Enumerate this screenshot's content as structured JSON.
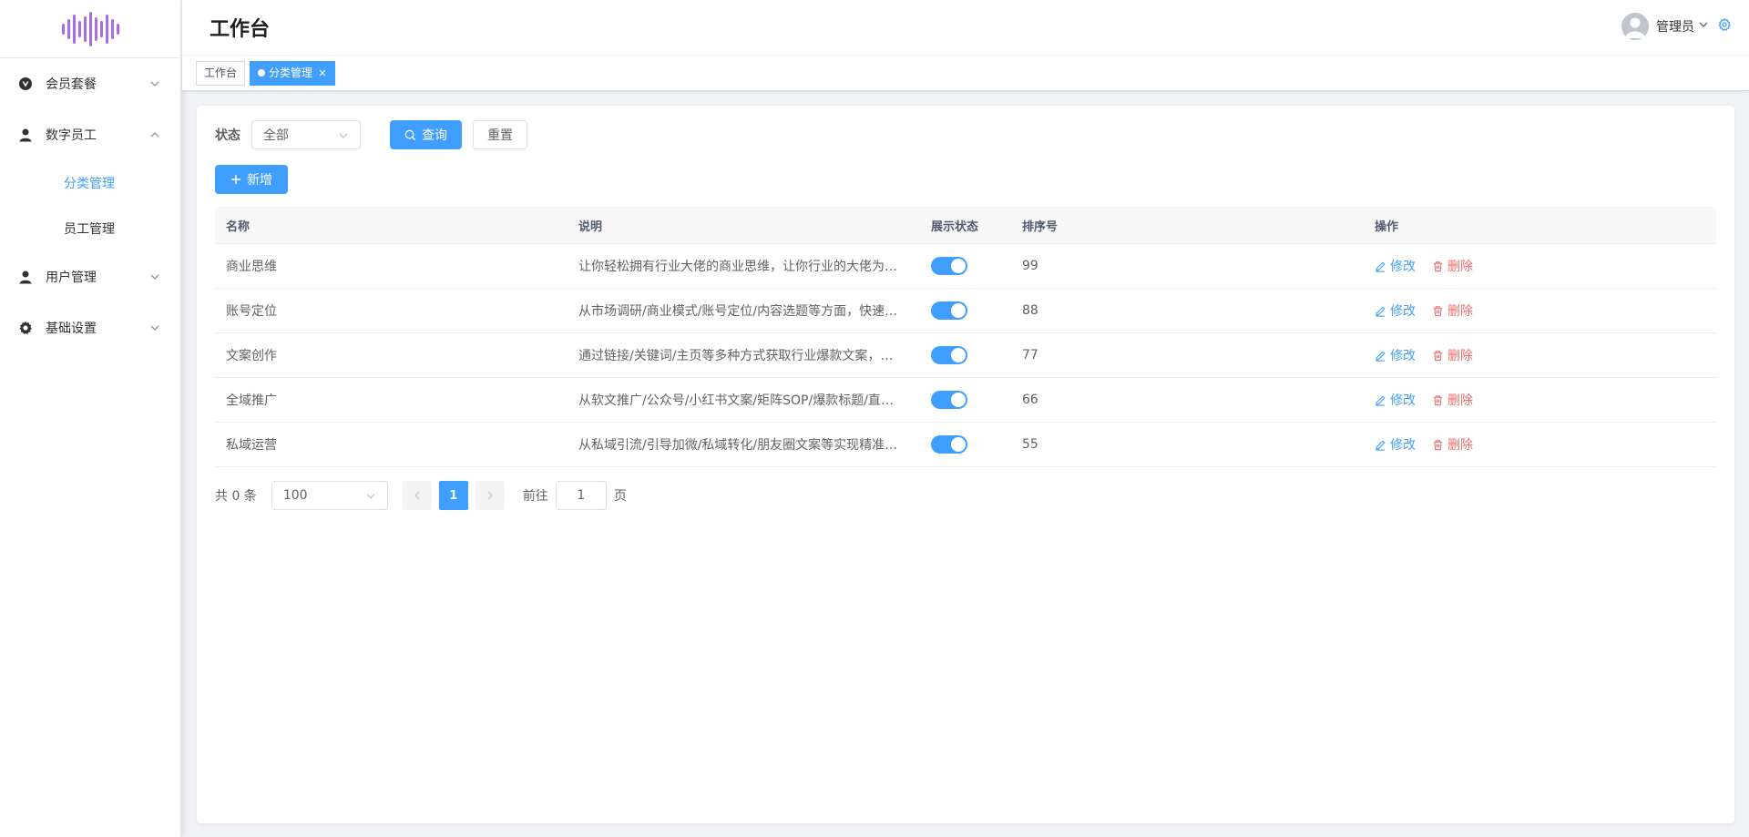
{
  "sidebar": {
    "items": [
      {
        "label": "会员套餐",
        "icon": "vuejs-icon",
        "expanded": false
      },
      {
        "label": "数字员工",
        "icon": "user-icon",
        "expanded": true,
        "children": [
          {
            "label": "分类管理",
            "active": true
          },
          {
            "label": "员工管理",
            "active": false
          }
        ]
      },
      {
        "label": "用户管理",
        "icon": "user-icon",
        "expanded": false
      },
      {
        "label": "基础设置",
        "icon": "gear-icon",
        "expanded": false
      }
    ]
  },
  "header": {
    "title": "工作台",
    "user_name": "管理员"
  },
  "tags": [
    {
      "label": "工作台",
      "active": false
    },
    {
      "label": "分类管理",
      "active": true,
      "close": "×"
    }
  ],
  "filter": {
    "status_label": "状态",
    "status_value": "全部",
    "search_label": "查询",
    "reset_label": "重置",
    "add_label": "新增"
  },
  "table": {
    "columns": [
      "名称",
      "说明",
      "展示状态",
      "排序号",
      "操作"
    ],
    "rows": [
      {
        "name": "商业思维",
        "desc": "让你轻松拥有行业大佬的商业思维，让你行业的大佬为…",
        "enabled": true,
        "sort": "99"
      },
      {
        "name": "账号定位",
        "desc": "从市场调研/商业模式/账号定位/内容选题等方面，快速…",
        "enabled": true,
        "sort": "88"
      },
      {
        "name": "文案创作",
        "desc": "通过链接/关键词/主页等多种方式获取行业爆款文案，并…",
        "enabled": true,
        "sort": "77"
      },
      {
        "name": "全域推广",
        "desc": "从软文推广/公众号/小红书文案/矩阵SOP/爆款标题/直播…",
        "enabled": true,
        "sort": "66"
      },
      {
        "name": "私域运营",
        "desc": "从私域引流/引导加微/私域转化/朋友圈文案等实现精准…",
        "enabled": true,
        "sort": "55"
      }
    ],
    "edit_label": "修改",
    "delete_label": "删除"
  },
  "pagination": {
    "total_text": "共 0 条",
    "page_size": "100",
    "current_page": "1",
    "jump_label": "前往",
    "jump_value": "1",
    "page_unit": "页"
  },
  "colors": {
    "accent": "#409eff",
    "danger": "#f56c6c",
    "logo": "#a66ee6"
  }
}
